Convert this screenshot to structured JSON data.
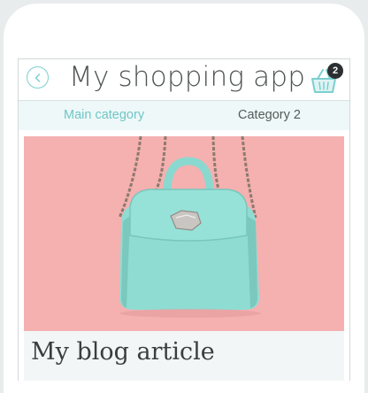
{
  "app": {
    "title": "My shopping app",
    "cart_count": "2"
  },
  "tabs": [
    {
      "label": "Main category",
      "active": true
    },
    {
      "label": "Category 2",
      "active": false
    }
  ],
  "article": {
    "title": "My blog article",
    "image_icon": "mint-backpack-photo"
  },
  "colors": {
    "accent": "#71c6c7",
    "photo_background": "#f5b0b0",
    "tabs_background": "#eef8f8",
    "badge": "#2b2f31"
  },
  "icons": {
    "back": "chevron-left-icon",
    "cart": "shopping-basket-icon"
  }
}
